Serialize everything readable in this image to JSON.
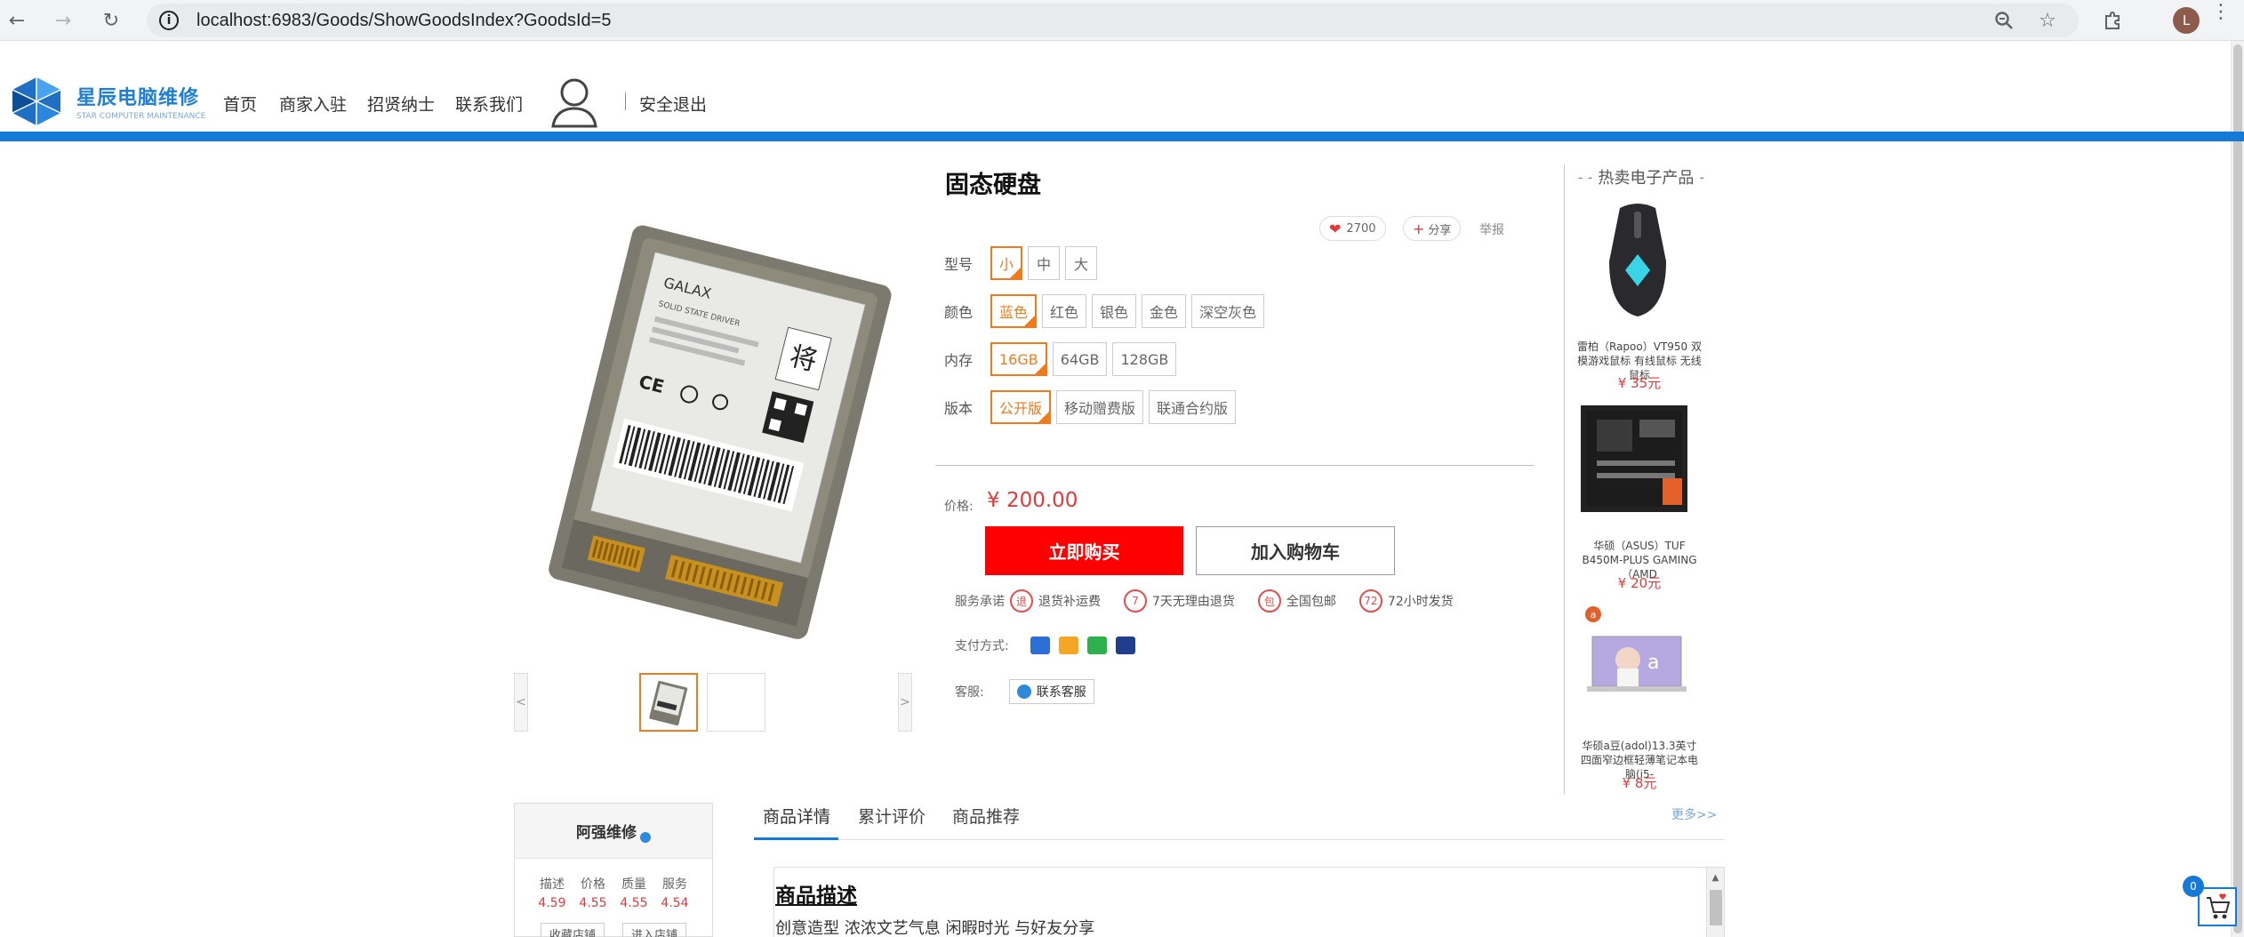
{
  "browser": {
    "url": "localhost:6983/Goods/ShowGoodsIndex?GoodsId=5",
    "profile_initial": "L"
  },
  "site": {
    "brand_cn": "星辰电脑维修",
    "brand_en": "STAR COMPUTER MAINTENANCE",
    "nav": [
      "首页",
      "商家入驻",
      "招贤纳士",
      "联系我们"
    ],
    "logout": "安全退出"
  },
  "product": {
    "title": "固态硬盘",
    "likes": "2700",
    "share": "分享",
    "report": "举报",
    "options": [
      {
        "label": "型号",
        "values": [
          "小",
          "中",
          "大"
        ],
        "selected": 0
      },
      {
        "label": "颜色",
        "values": [
          "蓝色",
          "红色",
          "银色",
          "金色",
          "深空灰色"
        ],
        "selected": 0
      },
      {
        "label": "内存",
        "values": [
          "16GB",
          "64GB",
          "128GB"
        ],
        "selected": 0
      },
      {
        "label": "版本",
        "values": [
          "公开版",
          "移动赠费版",
          "联通合约版"
        ],
        "selected": 0
      }
    ],
    "price_label": "价格:",
    "price": "¥ 200.00",
    "buy_now": "立即购买",
    "add_to_cart": "加入购物车",
    "service_label": "服务承诺",
    "services": [
      {
        "icon": "退",
        "text": "退货补运费"
      },
      {
        "icon": "7",
        "text": "7天无理由退货"
      },
      {
        "icon": "包",
        "text": "全国包邮"
      },
      {
        "icon": "72",
        "text": "72小时发货"
      }
    ],
    "payment_label": "支付方式:",
    "support_label": "客服:",
    "support_button": "联系客服"
  },
  "hot": {
    "title": "热卖电子产品",
    "items": [
      {
        "name": "雷柏（Rapoo）VT950 双模游戏鼠标 有线鼠标 无线鼠标",
        "price": "¥ 35元"
      },
      {
        "name": "华硕（ASUS）TUF B450M-PLUS GAMING（AMD",
        "price": "¥ 20元"
      },
      {
        "name": "华硕a豆(adol)13.3英寸四面窄边框轻薄笔记本电脑(i5-",
        "price": "¥ 8元"
      }
    ]
  },
  "shop": {
    "name": "阿强维修",
    "stat_labels": [
      "描述",
      "价格",
      "质量",
      "服务"
    ],
    "stat_values": [
      "4.59",
      "4.55",
      "4.55",
      "4.54"
    ],
    "btn_fav": "收藏店铺",
    "btn_enter": "进入店铺"
  },
  "tabs": {
    "items": [
      "商品详情",
      "累计评价",
      "商品推荐"
    ],
    "more": "更多>>"
  },
  "detail": {
    "heading": "商品描述",
    "line1": "创意造型 浓浓文艺气息 闲暇时光 与好友分享"
  },
  "cart": {
    "count": "0"
  },
  "colors": {
    "accent_blue": "#1479d7",
    "selected_orange": "#f07a1c",
    "price_red": "#e4393c",
    "buy_red": "#ff0000"
  }
}
